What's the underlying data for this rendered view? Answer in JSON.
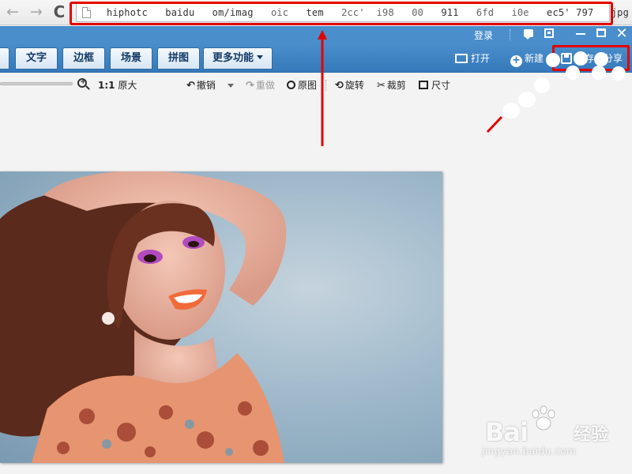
{
  "browser": {
    "back_icon": "←",
    "forward_icon": "→",
    "reload_icon": "C",
    "url_parts": [
      "hiphotc",
      "baidu",
      "om/imag",
      "oic",
      "tem",
      "2cc'",
      "i98",
      "00",
      "911",
      "6fd",
      "i0e",
      "ec5'",
      "797",
      "jpg"
    ]
  },
  "titlebar": {
    "login": "登录",
    "close_icon": "✕"
  },
  "tabs": {
    "text": "文字",
    "border": "边框",
    "scene": "场景",
    "collage": "拼图",
    "more": "更多功能"
  },
  "actions": {
    "open": "打开",
    "new": "新建",
    "save_share": "保存与分享",
    "plus_icon": "+"
  },
  "toolbar": {
    "ratio": "1:1",
    "original_size": "原大",
    "undo_icon": "↶",
    "undo": "撤销",
    "redo_icon": "↷",
    "redo": "重做",
    "original": "原图",
    "rotate_icon": "⟲",
    "rotate": "旋转",
    "crop_icon": "✂",
    "crop": "裁剪",
    "size": "尺寸"
  },
  "watermark": {
    "brand": "Bai",
    "brand_suffix": "经验",
    "site": "jingyan.baidu.com"
  },
  "colors": {
    "accent_blue": "#4a8ecc",
    "annotation_red": "#e30000"
  }
}
